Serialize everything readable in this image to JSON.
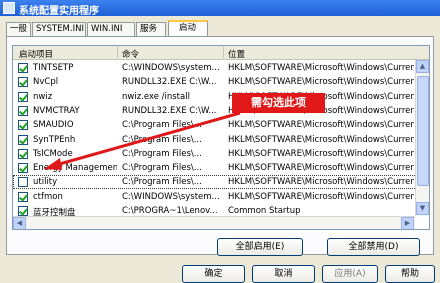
{
  "window": {
    "title": "系统配置实用程序"
  },
  "tabs": [
    {
      "label": "一般"
    },
    {
      "label": "SYSTEM.INI"
    },
    {
      "label": "WIN.INI"
    },
    {
      "label": "服务"
    },
    {
      "label": "启动"
    }
  ],
  "table": {
    "columns": [
      "启动项目",
      "命令",
      "位置"
    ],
    "rows": [
      {
        "checked": true,
        "item": "TINTSETP",
        "command": "C:\\WINDOWS\\system...",
        "location": "HKLM\\SOFTWARE\\Microsoft\\Windows\\Current..."
      },
      {
        "checked": true,
        "item": "NvCpl",
        "command": "RUNDLL32.EXE C:\\W...",
        "location": "HKLM\\SOFTWARE\\Microsoft\\Windows\\Current..."
      },
      {
        "checked": true,
        "item": "nwiz",
        "command": "nwiz.exe /install",
        "location": "HKLM\\SOFTWARE\\Microsoft\\Windows\\Current..."
      },
      {
        "checked": true,
        "item": "NVMCTRAY",
        "command": "RUNDLL32.EXE C:\\W...",
        "location": "HKLM\\SOFTWARE\\Microsoft\\Windows\\Current..."
      },
      {
        "checked": true,
        "item": "SMAUDIO",
        "command": "C:\\Program Files\\...",
        "location": "HKLM\\SOFTWARE\\Microsoft\\Windows\\Current..."
      },
      {
        "checked": true,
        "item": "SynTPEnh",
        "command": "C:\\Program Files\\...",
        "location": "HKLM\\SOFTWARE\\Microsoft\\Windows\\Current..."
      },
      {
        "checked": true,
        "item": "TslCMode",
        "command": "C:\\Program Files\\...",
        "location": "HKLM\\SOFTWARE\\Microsoft\\Windows\\Current..."
      },
      {
        "checked": true,
        "item": "Energy Management",
        "command": "C:\\Program Files\\...",
        "location": "HKLM\\SOFTWARE\\Microsoft\\Windows\\Current..."
      },
      {
        "checked": false,
        "item": "utility",
        "command": "C:\\Program Files\\...",
        "location": "HKLM\\SOFTWARE\\Microsoft\\Windows\\Current..."
      },
      {
        "checked": true,
        "item": "ctfmon",
        "command": "C:\\WINDOWS\\system...",
        "location": "HKLM\\SOFTWARE\\Microsoft\\Windows\\Current..."
      },
      {
        "checked": true,
        "item": "蓝牙控制盘",
        "command": "C:\\PROGRA~1\\Lenov...",
        "location": "Common Startup"
      }
    ]
  },
  "annotation": {
    "text": "需勾选此项",
    "color": "#e01818"
  },
  "buttons": {
    "enable_all": "全部启用(E)",
    "disable_all": "全部禁用(D)",
    "ok": "确定",
    "cancel": "取消",
    "apply": "应用(A)",
    "help": "帮助"
  }
}
